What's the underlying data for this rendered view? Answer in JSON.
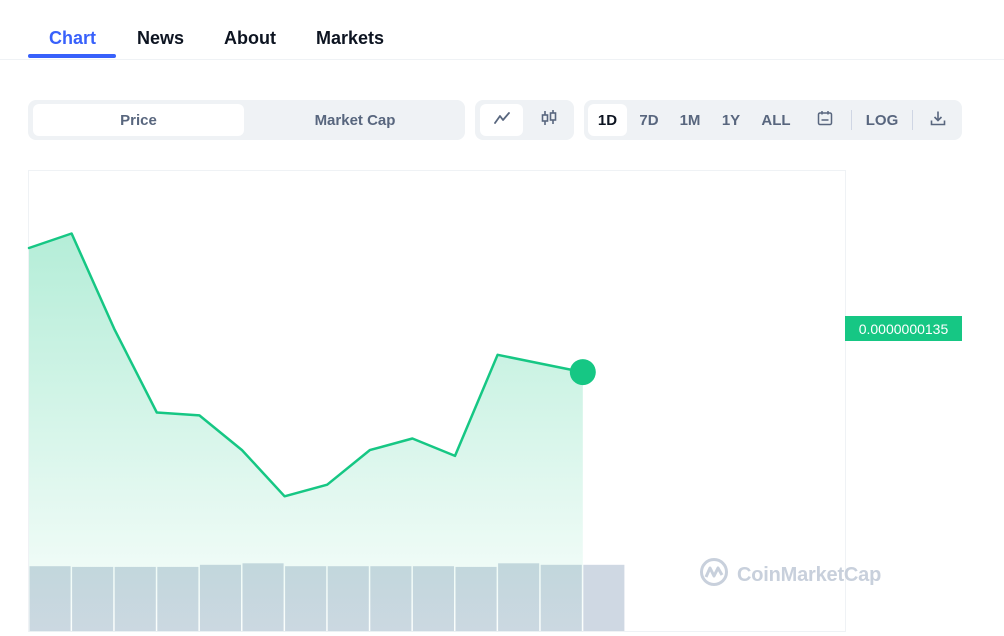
{
  "tabs": [
    {
      "label": "Chart",
      "active": true
    },
    {
      "label": "News",
      "active": false
    },
    {
      "label": "About",
      "active": false
    },
    {
      "label": "Markets",
      "active": false
    }
  ],
  "toolbar": {
    "metric_options": [
      "Price",
      "Market Cap"
    ],
    "metric_selected": "Price",
    "chart_types": [
      {
        "icon": "line-chart-icon",
        "active": true
      },
      {
        "icon": "candlestick-icon",
        "active": false
      }
    ],
    "ranges": [
      "1D",
      "7D",
      "1M",
      "1Y",
      "ALL"
    ],
    "range_selected": "1D",
    "calendar_icon": "calendar-icon",
    "log_label": "LOG",
    "download_icon": "download-icon"
  },
  "price_badge": "0.0000000135",
  "watermark": "CoinMarketCap",
  "colors": {
    "accent": "#3861fb",
    "up_green": "#16c784",
    "volume_bar": "#cfd8e3",
    "muted_text": "#58667e"
  },
  "chart_data": {
    "type": "line",
    "series": [
      {
        "values": [
          1.78e-08,
          1.83e-08,
          1.5e-08,
          1.21e-08,
          1.2e-08,
          1.08e-08,
          9.2e-09,
          9.6e-09,
          1.08e-08,
          1.12e-08,
          1.06e-08,
          1.41e-08,
          1.38e-08,
          1.35e-08
        ]
      }
    ],
    "volume": [
      0.9,
      0.89,
      0.89,
      0.89,
      0.92,
      0.94,
      0.9,
      0.9,
      0.9,
      0.9,
      0.89,
      0.94,
      0.92,
      0.92
    ],
    "last_value": "0.0000000135",
    "ylim": [
      4.5e-09,
      2.05e-08
    ],
    "grid": false,
    "legend": "none"
  }
}
